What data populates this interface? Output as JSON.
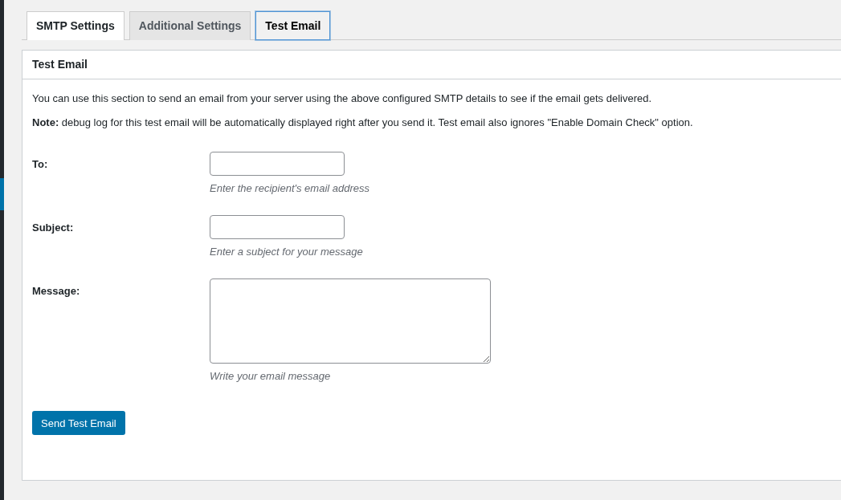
{
  "tabs": [
    {
      "label": "SMTP Settings",
      "selected": false,
      "hovered": true
    },
    {
      "label": "Additional Settings",
      "selected": false,
      "hovered": false
    },
    {
      "label": "Test Email",
      "selected": true,
      "hovered": false
    }
  ],
  "panel": {
    "title": "Test Email",
    "intro": "You can use this section to send an email from your server using the above configured SMTP details to see if the email gets delivered.",
    "note": "**Note:** debug log for this test email will be automatically displayed right after you send it. Test email also ignores \"Enable Domain Check\" option.",
    "fields": [
      {
        "kind": "input",
        "label": "To:",
        "hint": "Enter the recipient's email address"
      },
      {
        "kind": "input",
        "label": "Subject:",
        "hint": "Enter a subject for your message"
      },
      {
        "kind": "textarea",
        "label": "Message:",
        "hint": "Write your email message"
      }
    ],
    "button": "Send Test Email"
  }
}
